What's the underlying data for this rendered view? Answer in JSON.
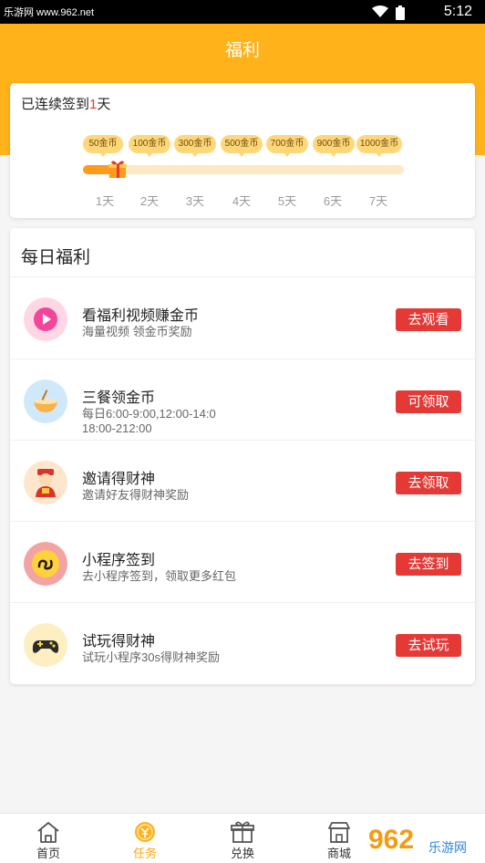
{
  "status_bar": {
    "site_tag": "乐游网 www.962.net",
    "time": "5:12"
  },
  "header": {
    "title": "福利"
  },
  "checkin": {
    "prefix": "已连续签到",
    "days": "1",
    "suffix": "天",
    "progress_fraction": 0.1,
    "rewards": [
      "50金币",
      "100金币",
      "300金币",
      "500金币",
      "700金币",
      "900金币",
      "1000金币"
    ],
    "day_labels": [
      "1天",
      "2天",
      "3天",
      "4天",
      "5天",
      "6天",
      "7天"
    ]
  },
  "welfare": {
    "title": "每日福利",
    "tasks": [
      {
        "icon": "play-icon",
        "name": "看福利视频赚金币",
        "desc": "海量视频 领金币奖励",
        "button": "去观看"
      },
      {
        "icon": "bowl-icon",
        "name": "三餐领金币",
        "desc": "每日6:00-9:00,12:00-14:0 18:00-212:00",
        "button": "可领取"
      },
      {
        "icon": "fortune-god-icon",
        "name": "邀请得财神",
        "desc": "邀请好友得财神奖励",
        "button": "去领取"
      },
      {
        "icon": "mini-program-icon",
        "name": "小程序签到",
        "desc": "去小程序签到，领取更多红包",
        "button": "去签到"
      },
      {
        "icon": "gamepad-icon",
        "name": "试玩得财神",
        "desc": "试玩小程序30s得财神奖励",
        "button": "去试玩"
      }
    ]
  },
  "tabbar": {
    "tabs": [
      {
        "label": "首页",
        "icon": "home-icon"
      },
      {
        "label": "任务",
        "icon": "coin-icon"
      },
      {
        "label": "兑换",
        "icon": "gift-icon"
      },
      {
        "label": "商城",
        "icon": "store-icon"
      }
    ]
  },
  "watermark": {
    "text": "962",
    "sub": "乐游网"
  },
  "colors": {
    "accent": "#ffb21a",
    "button": "#e53935",
    "active_tab": "#ffa60a"
  }
}
